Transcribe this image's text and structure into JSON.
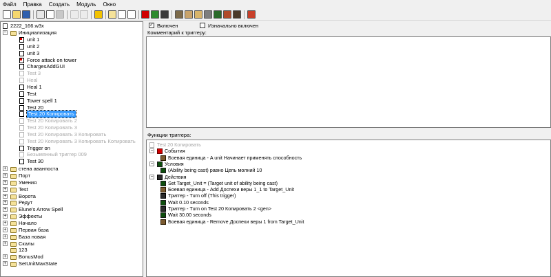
{
  "menu": [
    "Файл",
    "Правка",
    "Создать",
    "Модуль",
    "Окно"
  ],
  "tree": {
    "map_file": "2222_166.w3x",
    "root_folder": "Инициализация",
    "root_items": [
      {
        "label": "unit 1",
        "state": "special"
      },
      {
        "label": "unit 2",
        "state": "normal"
      },
      {
        "label": "unit 3",
        "state": "normal"
      },
      {
        "label": "Force attack on tower",
        "state": "special"
      },
      {
        "label": "ChargesAddGUI",
        "state": "normal"
      },
      {
        "label": "Test 3",
        "state": "disabled"
      },
      {
        "label": "Heal",
        "state": "disabled"
      },
      {
        "label": "Heal 1",
        "state": "normal"
      },
      {
        "label": "Test",
        "state": "normal"
      },
      {
        "label": "Tower spell 1",
        "state": "normal"
      },
      {
        "label": "Test 20",
        "state": "normal"
      },
      {
        "label": "Test 20 Копировать",
        "state": "selected"
      },
      {
        "label": "Test 20 Копировать 2",
        "state": "disabled"
      },
      {
        "label": "Test 20 Копировать 3",
        "state": "disabled"
      },
      {
        "label": "Test 20 Копировать 3 Копировать",
        "state": "disabled"
      },
      {
        "label": "Test 20 Копировать 3 Копировать Копировать",
        "state": "disabled"
      },
      {
        "label": "Trigger on",
        "state": "normal"
      },
      {
        "label": "Безымянный триггер 009",
        "state": "disabled"
      },
      {
        "label": "Test 30",
        "state": "normal"
      }
    ],
    "folders": [
      {
        "label": "стена аванпоста",
        "expandable": true
      },
      {
        "label": "Порт",
        "expandable": true
      },
      {
        "label": "Умения",
        "expandable": true
      },
      {
        "label": "Test",
        "expandable": true
      },
      {
        "label": "Ворота",
        "expandable": true
      },
      {
        "label": "Редут",
        "expandable": true
      },
      {
        "label": "Elune's Arrow Spell",
        "expandable": true
      },
      {
        "label": "Эффекты",
        "expandable": true
      },
      {
        "label": "Начало",
        "expandable": true
      },
      {
        "label": "Первая база",
        "expandable": true
      },
      {
        "label": "База новая",
        "expandable": true
      },
      {
        "label": "Скалы",
        "expandable": true
      },
      {
        "label": "123",
        "expandable": false
      },
      {
        "label": "BonusMod",
        "expandable": true
      },
      {
        "label": "SetUnitMaxState",
        "expandable": true
      }
    ]
  },
  "trigger": {
    "enabled_label": "Включен",
    "enabled": true,
    "initially_on_label": "Изначально включен",
    "initially_on": false,
    "comment_label": "Комментарий к триггеру:",
    "comment_text": "",
    "functions_label": "Функции триггера:",
    "trigger_name": "Test 20 Копировать",
    "events_label": "События",
    "events": [
      {
        "text": "Боевая единица - A unit Начинает применять способность",
        "icon": "unit-icon"
      }
    ],
    "conditions_label": "Условия",
    "conditions": [
      {
        "text": "(Ability being cast) равно Цепь молний 10",
        "icon": "ability-icon"
      }
    ],
    "actions_label": "Действия",
    "actions": [
      {
        "text": "Set Target_Unit = (Target unit of ability being cast)",
        "icon": "set-variable-icon"
      },
      {
        "text": "Боевая единица - Add Доспехи веры 1_1 to Target_Unit",
        "icon": "unit-icon"
      },
      {
        "text": "Триггер - Turn off (This trigger)",
        "icon": "trigger-icon"
      },
      {
        "text": "Wait 0.10 seconds",
        "icon": "wait-icon"
      },
      {
        "text": "Триггер - Turn on Test 20 Копировать 2 <gen>",
        "icon": "trigger-icon"
      },
      {
        "text": "Wait 30.00 seconds",
        "icon": "wait-icon"
      },
      {
        "text": "Боевая единица - Remove Доспехи веры 1 from Target_Unit",
        "icon": "unit-icon"
      }
    ]
  },
  "colors": {
    "selection": "#3399ff",
    "disabled_text": "#a8a8a8",
    "folder_fill": "#f5e29a",
    "event_flag": "#d00000"
  }
}
